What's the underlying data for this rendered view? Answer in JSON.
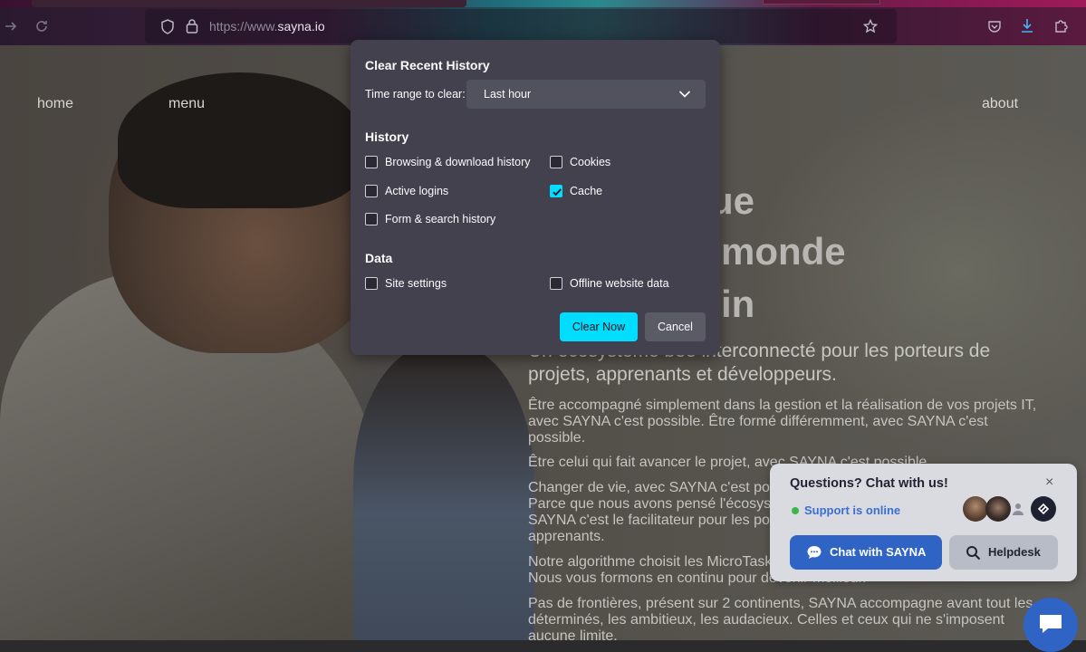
{
  "browser": {
    "url_prefix": "https://www.",
    "url_domain": "sayna.io"
  },
  "page": {
    "nav": {
      "home": "home",
      "menu": "menu",
      "about": "about"
    },
    "hero_fragments": [
      "ue",
      "monde",
      "in"
    ],
    "subtitle_a": "Un écosystème bee",
    "subtitle_b": "interconnecté pour les porteurs de",
    "subtitle_c": "projets, apprenants et développeurs.",
    "paragraphs": {
      "p1": "Être accompagné simplement dans la gestion et la réalisation de vos projets IT, avec SAYNA c'est possible. Être formé différemment, avec SAYNA c'est possible.",
      "p2": "Être celui qui fait avancer le projet, avec SAYNA c'est possible.",
      "p3a": "Changer de vie, avec SAYNA c'est po",
      "p3b": "Parce que nous avons pensé l'écosys",
      "p3c": "SAYNA c'est le facilitateur pour les po",
      "p3d": "apprenants.",
      "p4a": "Notre algorithme choisit les MicroTask",
      "p4b": "Nous vous formons en continu pour devenir meilleur.",
      "p5": "Pas de frontières, présent sur 2 continents, SAYNA accompagne avant tout les déterminés, les ambitieux, les audacieux. Celles et ceux qui ne s'imposent aucune limite."
    }
  },
  "dialog": {
    "title": "Clear Recent History",
    "time_range_label": "Time range to clear:",
    "time_range_value": "Last hour",
    "history_heading": "History",
    "history_items": [
      {
        "label": "Browsing & download history",
        "checked": false
      },
      {
        "label": "Cookies",
        "checked": false
      },
      {
        "label": "Active logins",
        "checked": false
      },
      {
        "label": "Cache",
        "checked": true
      },
      {
        "label": "Form & search history",
        "checked": false
      }
    ],
    "data_heading": "Data",
    "data_items": [
      {
        "label": "Site settings",
        "checked": false
      },
      {
        "label": "Offline website data",
        "checked": false
      }
    ],
    "clear_button": "Clear Now",
    "cancel_button": "Cancel",
    "accent_color": "#00ddff"
  },
  "chat_widget": {
    "title": "Questions? Chat with us!",
    "close": "×",
    "status": "Support is online",
    "chat_button": "Chat with SAYNA",
    "helpdesk_button": "Helpdesk",
    "brand_color": "#2f63c4",
    "status_color": "#3bb54a"
  }
}
